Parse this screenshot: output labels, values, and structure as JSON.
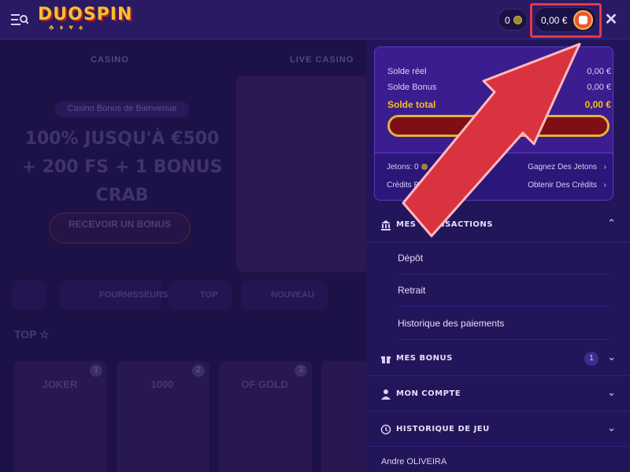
{
  "header": {
    "logo": "DUOSPIN",
    "logo_sub": "♣ ♦ ♥ ♠",
    "chips_value": "0",
    "balance": "0,00 €",
    "icons": {
      "menu": "menu-search-icon",
      "chip": "coin-icon",
      "wallet": "wallet-icon",
      "close": "close-icon"
    }
  },
  "background": {
    "tabs": [
      "CASINO",
      "LIVE CASINO"
    ],
    "promo_label": "Casino Bonus de Bienvenue",
    "promo_title": "100% JUSQU'À €500 + 200 FS + 1 BONUS CRAB",
    "promo_button": "RECEVOIR UN BONUS",
    "categories": [
      "",
      "FOURNISSEURS",
      "TOP",
      "NOUVEAU"
    ],
    "top_label": "TOP ☆",
    "games": [
      {
        "rank": "1",
        "name": "JOKER"
      },
      {
        "rank": "2",
        "name": "1000"
      },
      {
        "rank": "3",
        "name": "OF GOLD"
      },
      {
        "rank": "",
        "name": ""
      }
    ]
  },
  "wallet": {
    "rows": [
      {
        "label": "Solde réel",
        "value": "0,00 €"
      },
      {
        "label": "Solde Bonus",
        "value": "0,00 €"
      },
      {
        "label": "Solde total",
        "value": "0,00 €"
      }
    ],
    "jetons_label": "Jetons: 0",
    "credits_label": "Crédits B",
    "earn_link": "Gagnez Des Jetons",
    "credits_link": "Obtenir Des Crédits"
  },
  "menu": {
    "transactions": {
      "title": "MES TRANSACTIONS",
      "items": [
        "Dépôt",
        "Retrait",
        "Historique des paiements"
      ]
    },
    "bonus": {
      "title": "MES BONUS",
      "badge": "1"
    },
    "account": {
      "title": "MON COMPTE"
    },
    "history": {
      "title": "HISTORIQUE DE JEU"
    },
    "user": "Andre OLIVEIRA"
  },
  "colors": {
    "accent_gold": "#f4c01e",
    "highlight_red": "#e23a48",
    "panel_bg": "#23155a",
    "card_bg": "#3b1d8f"
  }
}
